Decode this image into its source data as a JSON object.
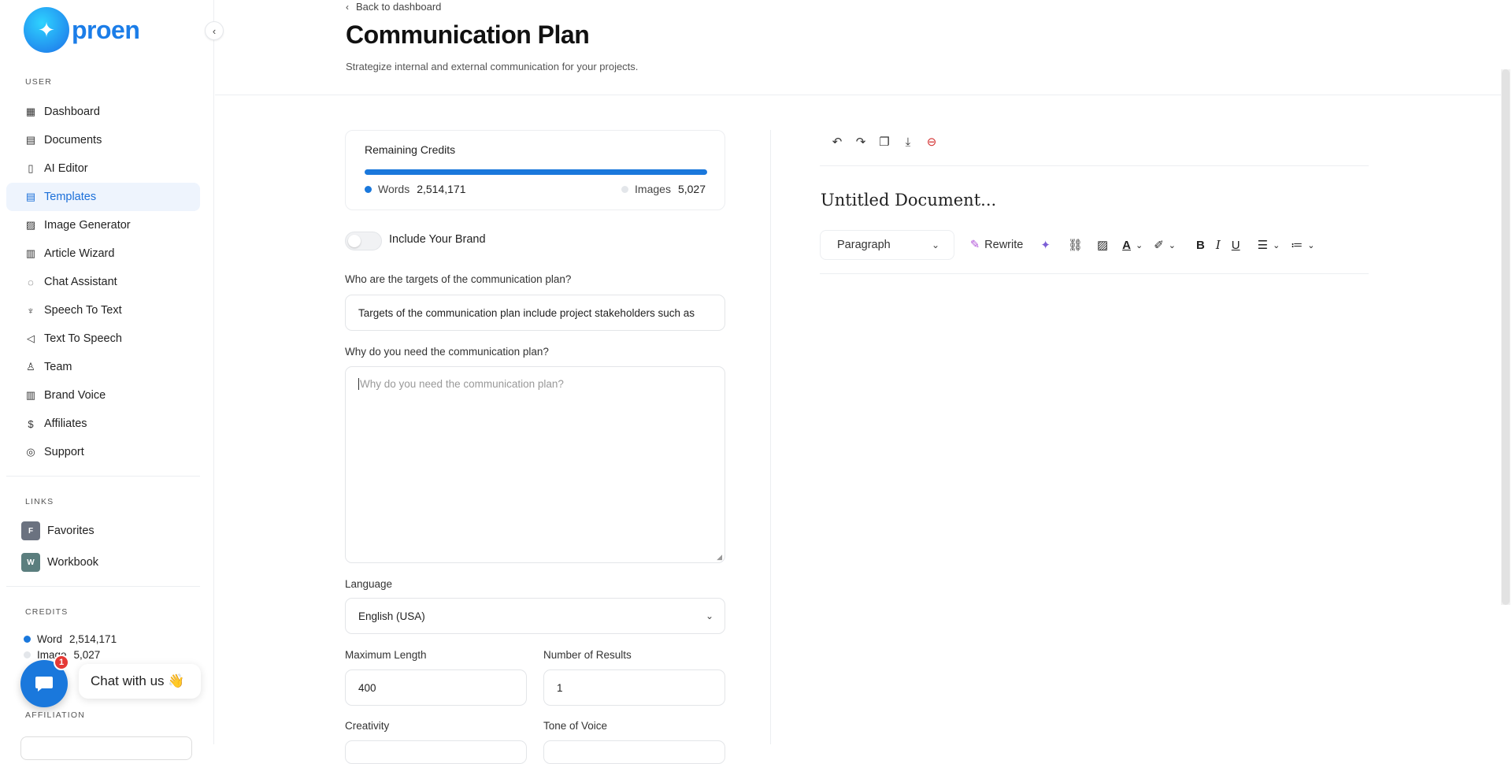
{
  "app": {
    "logo_text": "proen",
    "logo_glyph": "✦"
  },
  "sidebar": {
    "section_user": "USER",
    "items": [
      {
        "label": "Dashboard",
        "icon": "dashboard-icon",
        "glyph": "▦"
      },
      {
        "label": "Documents",
        "icon": "archive-icon",
        "glyph": "▤"
      },
      {
        "label": "AI Editor",
        "icon": "editor-icon",
        "glyph": "▯"
      },
      {
        "label": "Templates",
        "icon": "template-icon",
        "glyph": "▤",
        "active": true
      },
      {
        "label": "Image Generator",
        "icon": "image-icon",
        "glyph": "▨"
      },
      {
        "label": "Article Wizard",
        "icon": "article-icon",
        "glyph": "▥"
      },
      {
        "label": "Chat Assistant",
        "icon": "chat-icon",
        "glyph": "◌"
      },
      {
        "label": "Speech To Text",
        "icon": "microphone-icon",
        "glyph": "♆"
      },
      {
        "label": "Text To Speech",
        "icon": "speaker-icon",
        "glyph": "◁"
      },
      {
        "label": "Team",
        "icon": "user-plus-icon",
        "glyph": "♙"
      },
      {
        "label": "Brand Voice",
        "icon": "brand-icon",
        "glyph": "▥"
      },
      {
        "label": "Affiliates",
        "icon": "dollar-icon",
        "glyph": "$"
      },
      {
        "label": "Support",
        "icon": "lifebuoy-icon",
        "glyph": "◎"
      }
    ],
    "section_links": "LINKS",
    "links": [
      {
        "letter": "F",
        "label": "Favorites",
        "color": "#6b7280"
      },
      {
        "letter": "W",
        "label": "Workbook",
        "color": "#5b7e7e"
      }
    ],
    "section_credits": "CREDITS",
    "credits": {
      "word_label": "Word",
      "word_value": "2,514,171",
      "image_label": "Image",
      "image_value": "5,027"
    },
    "section_affiliation": "AFFILIATION"
  },
  "chat_widget": {
    "label": "Chat with us 👋",
    "badge": "1"
  },
  "header": {
    "back_label": "Back to dashboard",
    "title": "Communication Plan",
    "subtitle": "Strategize internal and external communication for your projects."
  },
  "credits_card": {
    "title": "Remaining Credits",
    "words_label": "Words",
    "words_value": "2,514,171",
    "images_label": "Images",
    "images_value": "5,027",
    "words_fraction": 1.0
  },
  "form": {
    "brand_toggle_label": "Include Your Brand",
    "brand_toggle_on": false,
    "targets_label": "Who are the targets of the communication plan?",
    "targets_value": "Targets of the communication plan include project stakeholders such as",
    "why_label": "Why do you need the communication plan?",
    "why_placeholder": "Why do you need the communication plan?",
    "language_label": "Language",
    "language_value": "English (USA)",
    "max_length_label": "Maximum Length",
    "max_length_value": "400",
    "results_label": "Number of Results",
    "results_value": "1",
    "creativity_label": "Creativity",
    "tone_label": "Tone of Voice"
  },
  "editor": {
    "doc_title": "Untitled Document...",
    "paragraph_select": "Paragraph",
    "rewrite_label": "Rewrite"
  },
  "colors": {
    "accent": "#1a78dc",
    "active_bg": "#eef4fd",
    "danger": "#d32f2f"
  }
}
